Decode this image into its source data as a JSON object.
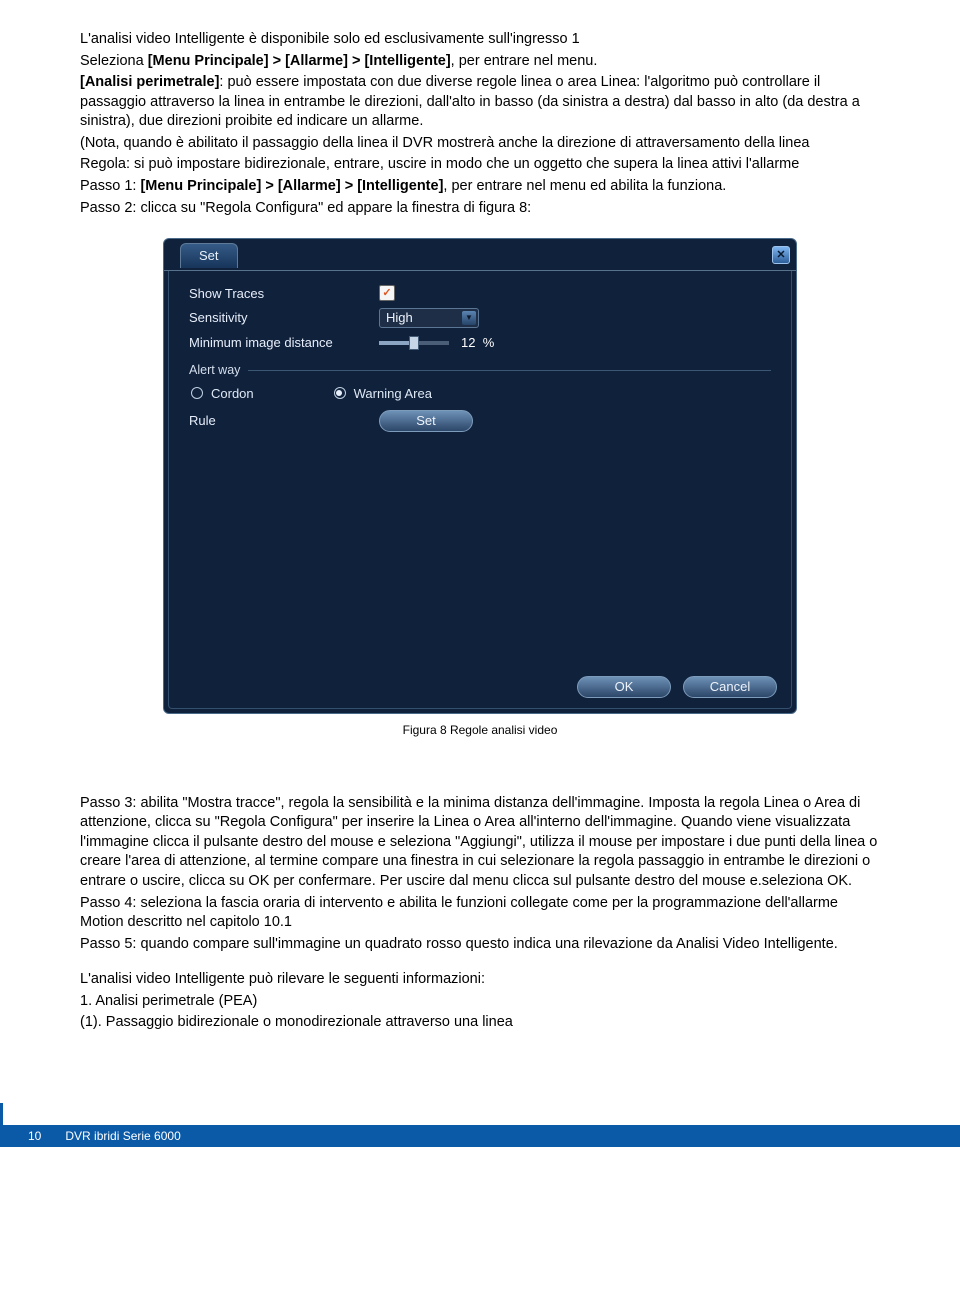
{
  "para1": "L'analisi video Intelligente è disponibile solo ed esclusivamente sull'ingresso 1",
  "para2_pre": "Seleziona ",
  "para2_bold": "[Menu Principale] > [Allarme] > [Intelligente]",
  "para2_post": ", per entrare nel menu.",
  "para3_bold": "[Analisi perimetrale]",
  "para3_post": ": può essere impostata con due diverse regole linea o area Linea: l'algoritmo può controllare il passaggio attraverso la linea in entrambe le direzioni, dall'alto in basso (da sinistra a destra) dal basso in alto (da destra a sinistra), due direzioni proibite ed indicare un allarme.",
  "para4": "(Nota, quando è abilitato il passaggio della linea il DVR mostrerà anche la direzione di attraversamento della linea",
  "para5": "Regola: si può impostare bidirezionale, entrare, uscire in modo che un oggetto che supera la linea attivi l'allarme",
  "para6_pre": "Passo 1: ",
  "para6_bold": "[Menu Principale] > [Allarme] > [Intelligente]",
  "para6_post": ", per entrare nel menu ed abilita la funziona.",
  "para7": "Passo 2: clicca su \"Regola Configura\" ed appare la finestra di figura 8:",
  "dvr": {
    "tab_title": "Set",
    "show_traces": "Show Traces",
    "sensitivity": "Sensitivity",
    "sensitivity_value": "High",
    "min_dist": "Minimum image distance",
    "min_dist_value": "12",
    "min_dist_unit": "%",
    "alert_way": "Alert way",
    "cordon": "Cordon",
    "warning_area": "Warning Area",
    "rule": "Rule",
    "rule_set": "Set",
    "ok": "OK",
    "cancel": "Cancel"
  },
  "caption": "Figura 8 Regole analisi video",
  "passo3": "Passo 3: abilita \"Mostra tracce\", regola la sensibilità e la minima distanza dell'immagine. Imposta la regola Linea o Area di attenzione, clicca su \"Regola Configura\" per inserire la Linea o Area all'interno dell'immagine. Quando viene visualizzata l'immagine clicca il pulsante destro del mouse e seleziona \"Aggiungi\", utilizza il mouse per impostare i due punti della linea o creare l'area di attenzione, al termine compare una finestra in cui selezionare la regola passaggio in entrambe le direzioni o entrare o uscire, clicca su OK per confermare. Per uscire dal menu clicca sul pulsante destro del mouse e.seleziona OK.",
  "passo4": "Passo 4: seleziona la fascia oraria di intervento e abilita le funzioni collegate come per la programmazione dell'allarme Motion descritto nel capitolo 10.1",
  "passo5": "Passo 5: quando compare sull'immagine un quadrato rosso questo indica una rilevazione da Analisi Video Intelligente.",
  "info_line": "L'analisi video Intelligente può rilevare le seguenti informazioni:",
  "list1": "1. Analisi perimetrale (PEA)",
  "list1a": "(1). Passaggio bidirezionale o monodirezionale attraverso una linea",
  "footer": {
    "pageno": "10",
    "series": "DVR ibridi Serie 6000"
  }
}
